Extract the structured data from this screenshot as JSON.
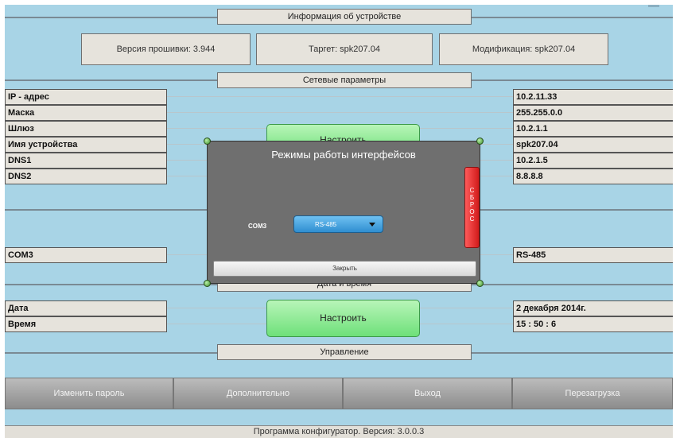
{
  "device_info": {
    "title": "Информация об устройстве",
    "firmware": "Версия прошивки: 3.944",
    "target": "Таргет: spk207.04",
    "modification": "Модификация: spk207.04"
  },
  "network": {
    "title": "Сетевые параметры",
    "rows": [
      {
        "label": "IP - адрес",
        "value": "10.2.11.33"
      },
      {
        "label": "Маска",
        "value": "255.255.0.0"
      },
      {
        "label": "Шлюз",
        "value": "10.2.1.1"
      },
      {
        "label": "Имя устройства",
        "value": "spk207.04"
      },
      {
        "label": "DNS1",
        "value": "10.2.1.5"
      },
      {
        "label": "DNS2",
        "value": "8.8.8.8"
      }
    ],
    "configure_label": "Настроить"
  },
  "interfaces": {
    "com3_label": "COM3",
    "com3_value": "RS-485"
  },
  "datetime": {
    "title": "Дата и время",
    "date_label": "Дата",
    "date_value": "2 декабря 2014г.",
    "time_label": "Время",
    "time_value": "15 : 50 : 6",
    "configure_label": "Настроить"
  },
  "management": {
    "title": "Управление",
    "buttons": [
      "Изменить пароль",
      "Дополнительно",
      "Выход",
      "Перезагрузка"
    ]
  },
  "footer": "Программа конфигуратор. Версия: 3.0.0.3",
  "modal": {
    "title": "Режимы работы интерфейсов",
    "reset_label": "СБРОС",
    "com_label": "COM3",
    "com_select_value": "RS-485",
    "close_label": "Закрыть"
  },
  "colors": {
    "background": "#a8d4e6",
    "panel": "#e6e3dc",
    "modal": "#6f6f6f",
    "accent_green": "#6ee07a",
    "accent_red": "#d21c1c",
    "accent_blue": "#2f8ed0"
  }
}
